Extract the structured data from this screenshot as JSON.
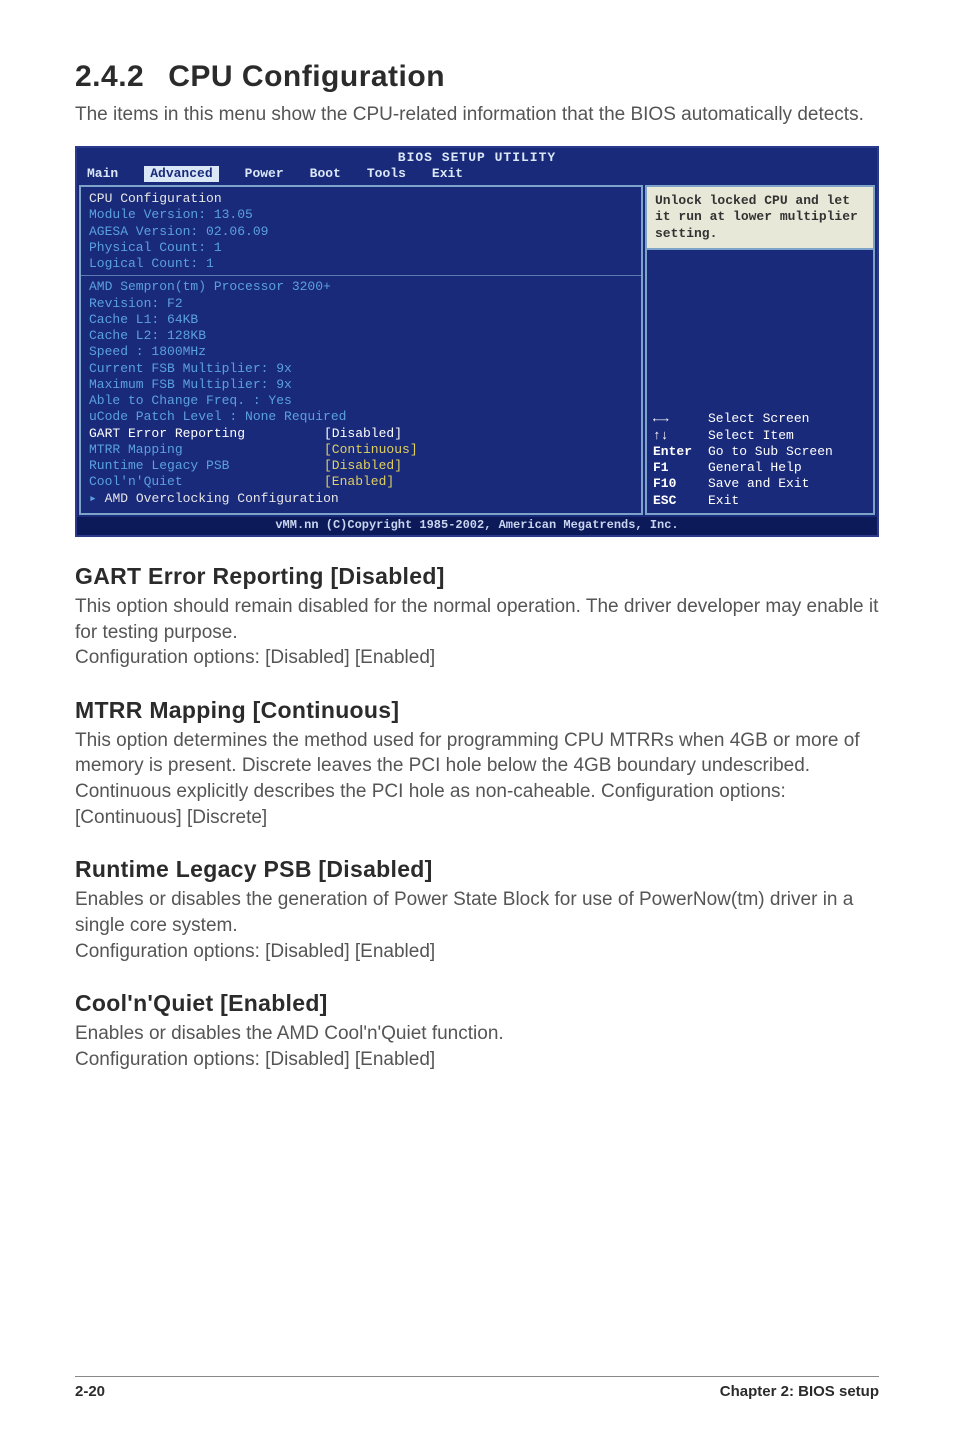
{
  "section": {
    "number": "2.4.2",
    "title": "CPU Configuration",
    "intro": "The items in this menu show the CPU-related information that the BIOS automatically detects."
  },
  "bios": {
    "title": "BIOS SETUP UTILITY",
    "tabs": [
      "Main",
      "Advanced",
      "Power",
      "Boot",
      "Tools",
      "Exit"
    ],
    "selected_tab": "Advanced",
    "header_lines": [
      "CPU Configuration",
      "Module Version: 13.05",
      "AGESA Version: 02.06.09",
      "Physical Count: 1",
      "Logical Count: 1"
    ],
    "info_lines": [
      "AMD Sempron(tm) Processor 3200+",
      "Revision: F2",
      "Cache L1: 64KB",
      "Cache L2: 128KB",
      "Speed   : 1800MHz",
      "Current FSB Multiplier: 9x",
      "Maximum FSB Multiplier: 9x",
      "Able to Change Freq.  : Yes",
      "uCode Patch Level     : None Required"
    ],
    "settings": [
      {
        "label": "GART Error Reporting",
        "value": "[Disabled]",
        "selected": true
      },
      {
        "label": "MTRR Mapping",
        "value": "[Continuous]",
        "selected": false
      },
      {
        "label": "Runtime Legacy PSB",
        "value": "[Disabled]",
        "selected": false
      },
      {
        "label": "Cool'n'Quiet",
        "value": "[Enabled]",
        "selected": false
      }
    ],
    "submenu": "AMD Overclocking Configuration",
    "help_text": "Unlock locked CPU and let it run at lower multiplier setting.",
    "keys": [
      {
        "k": "←→",
        "d": "Select Screen"
      },
      {
        "k": "↑↓",
        "d": "Select Item"
      },
      {
        "k": "Enter",
        "d": "Go to Sub Screen"
      },
      {
        "k": "F1",
        "d": "General Help"
      },
      {
        "k": "F10",
        "d": "Save and Exit"
      },
      {
        "k": "ESC",
        "d": "Exit"
      }
    ],
    "copyright": "vMM.nn (C)Copyright 1985-2002, American Megatrends, Inc."
  },
  "subsections": [
    {
      "title": "GART Error Reporting [Disabled]",
      "body": "This option should remain disabled for the normal operation. The driver developer may enable it for testing purpose.\nConfiguration options: [Disabled] [Enabled]"
    },
    {
      "title": "MTRR Mapping [Continuous]",
      "body": "This option determines the method used for programming CPU MTRRs when 4GB or more of memory is present. Discrete leaves the PCI hole below the 4GB boundary undescribed. Continuous explicitly describes the PCI hole as non-caheable. Configuration options: [Continuous] [Discrete]"
    },
    {
      "title": "Runtime Legacy PSB [Disabled]",
      "body": "Enables or disables the generation of Power State Block for use of PowerNow(tm) driver in a single core system.\nConfiguration options: [Disabled] [Enabled]"
    },
    {
      "title": "Cool'n'Quiet [Enabled]",
      "body": "Enables or disables the AMD Cool'n'Quiet function.\nConfiguration options: [Disabled] [Enabled]"
    }
  ],
  "footer": {
    "left": "2-20",
    "right": "Chapter 2: BIOS setup"
  }
}
